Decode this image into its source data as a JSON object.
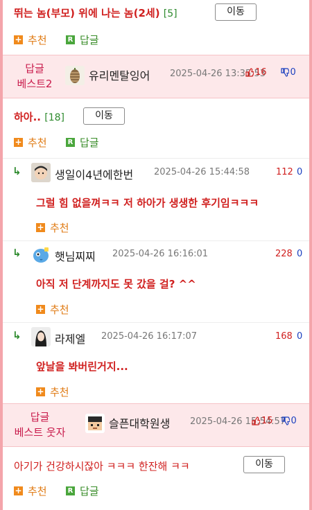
{
  "post1": {
    "title": "뛰는 놈(부모) 위에 나는 놈(2세)",
    "count": "[5]",
    "move_label": "이동",
    "recommend_label": "추천",
    "reply_label": "답글"
  },
  "best1": {
    "label_line1": "답글",
    "label_line2": "베스트2",
    "nick": "유리멘탈잉어",
    "date": "2025-04-26 13:35:53",
    "up": "16",
    "down": "0"
  },
  "post2": {
    "title": "하아..",
    "count": "[18]",
    "move_label": "이동",
    "recommend_label": "추천",
    "reply_label": "답글"
  },
  "replies": [
    {
      "nick": "생일이4년에한번",
      "date": "2025-04-26 15:44:58",
      "up": "112",
      "down": "0",
      "text": "그럴 힘 없을껴ㅋㅋ 저 하아가 생생한 후기임ㅋㅋㅋ",
      "recommend_label": "추천"
    },
    {
      "nick": "햇님찌찌",
      "date": "2025-04-26 16:16:01",
      "up": "228",
      "down": "0",
      "text": "아직 저 단계까지도 못 갔을 걸? ^^",
      "recommend_label": "추천"
    },
    {
      "nick": "라제엘",
      "date": "2025-04-26 16:17:07",
      "up": "168",
      "down": "0",
      "text": "앞날을 봐버린거지...",
      "recommend_label": "추천"
    }
  ],
  "best2": {
    "label_line1": "답글",
    "label_line2": "베스트 웃자",
    "nick": "슬픈대학원생",
    "date": "2025-04-26 15:54:57",
    "up": "15",
    "down": "0"
  },
  "post3": {
    "title": "아기가 건강하시잖아 ㅋㅋㅋ 한잔해 ㅋㅋ",
    "move_label": "이동",
    "recommend_label": "추천",
    "reply_label": "답글"
  },
  "colors": {
    "border": "#f4a5ab",
    "best_bg": "#fde8ea",
    "accent_red": "#d0201f",
    "count_green": "#2d8a2d"
  }
}
